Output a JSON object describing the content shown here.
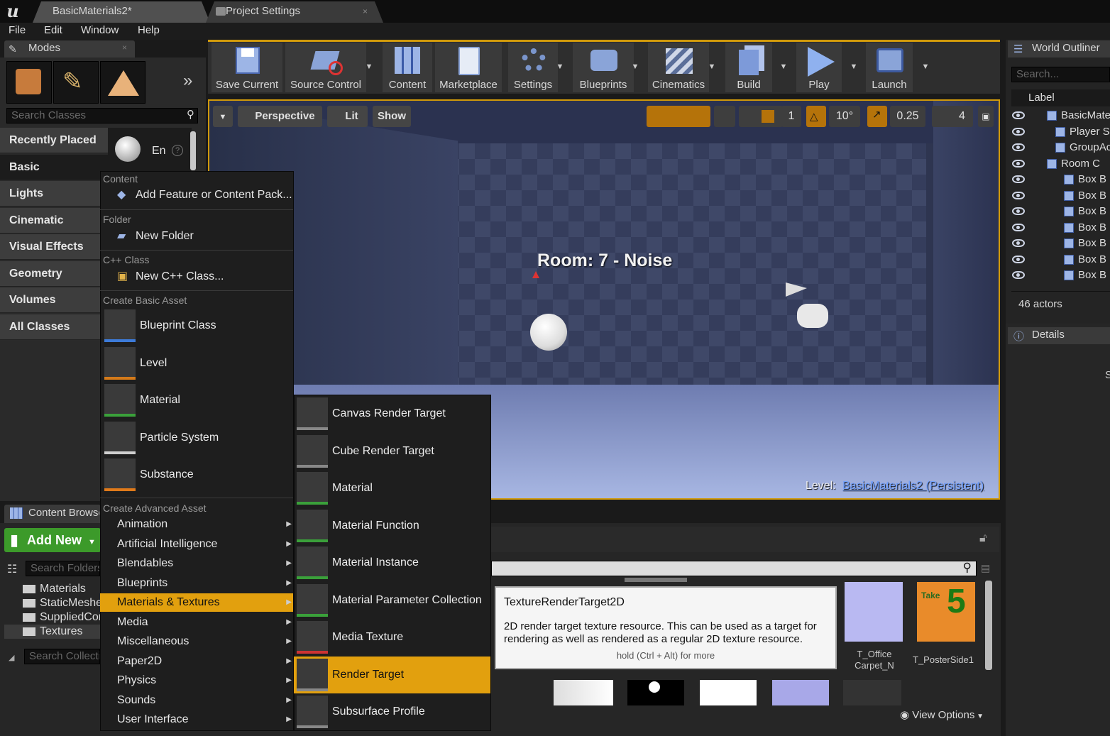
{
  "tabs": [
    {
      "label": "BasicMaterials2*"
    },
    {
      "label": "Project Settings"
    }
  ],
  "menubar": [
    "File",
    "Edit",
    "Window",
    "Help"
  ],
  "modes": {
    "title": "Modes",
    "search_placeholder": "Search Classes",
    "categories": [
      "Recently Placed",
      "Basic",
      "Lights",
      "Cinematic",
      "Visual Effects",
      "Geometry",
      "Volumes",
      "All Classes"
    ],
    "selected_category": "Basic",
    "placeable_label": "En"
  },
  "toolbar": {
    "buttons": [
      {
        "label": "Save Current",
        "icon": "save-icon"
      },
      {
        "label": "Source Control",
        "icon": "source-control-icon"
      },
      {
        "label": "Content",
        "icon": "content-icon"
      },
      {
        "label": "Marketplace",
        "icon": "marketplace-icon"
      },
      {
        "label": "Settings",
        "icon": "settings-icon"
      },
      {
        "label": "Blueprints",
        "icon": "blueprints-icon"
      },
      {
        "label": "Cinematics",
        "icon": "cinematics-icon"
      },
      {
        "label": "Build",
        "icon": "build-icon"
      },
      {
        "label": "Play",
        "icon": "play-icon"
      },
      {
        "label": "Launch",
        "icon": "launch-icon"
      }
    ]
  },
  "viewport": {
    "perspective": "Perspective",
    "lit": "Lit",
    "show": "Show",
    "grid_snap": "1",
    "rotation_snap": "10°",
    "scale_snap": "0.25",
    "camera_speed": "4",
    "room_text": "Room: 7 - Noise",
    "level_label": "Level:",
    "level_name": "BasicMaterials2 (Persistent)"
  },
  "world_outliner": {
    "title": "World Outliner",
    "search_placeholder": "Search...",
    "column": "Label",
    "rows": [
      "BasicMate",
      "Player S",
      "GroupAc",
      "Room C",
      "Box B",
      "Box B",
      "Box B",
      "Box B",
      "Box B",
      "Box B",
      "Box B",
      "Box B"
    ],
    "actor_count": "46 actors"
  },
  "details": {
    "title": "Details",
    "edge_text": "S"
  },
  "content_browser": {
    "title": "Content Browser",
    "add_new": "Add New",
    "search_folders": "Search Folders",
    "search_collections": "Search Collections",
    "folders": [
      "Materials",
      "StaticMeshes",
      "SuppliedContent",
      "Textures"
    ],
    "view_options": "View Options",
    "assets": [
      {
        "name": "T_Office Carpet_N"
      },
      {
        "name": "T_PosterSide1",
        "badge_word": "Take",
        "badge_number": "5"
      }
    ]
  },
  "context_menu": {
    "sections": {
      "content": "Content",
      "folder": "Folder",
      "cpp": "C++ Class",
      "basic": "Create Basic Asset",
      "advanced": "Create Advanced Asset"
    },
    "add_feature": "Add Feature or Content Pack...",
    "new_folder": "New Folder",
    "new_cpp": "New C++ Class...",
    "basic_assets": [
      "Blueprint Class",
      "Level",
      "Material",
      "Particle System",
      "Substance"
    ],
    "advanced_assets": [
      "Animation",
      "Artificial Intelligence",
      "Blendables",
      "Blueprints",
      "Materials & Textures",
      "Media",
      "Miscellaneous",
      "Paper2D",
      "Physics",
      "Sounds",
      "User Interface"
    ],
    "highlighted": "Materials & Textures"
  },
  "submenu": {
    "items": [
      "Canvas Render Target",
      "Cube Render Target",
      "Material",
      "Material Function",
      "Material Instance",
      "Material Parameter Collection",
      "Media Texture",
      "Render Target",
      "Subsurface Profile"
    ],
    "highlighted": "Render Target"
  },
  "tooltip": {
    "title": "TextureRenderTarget2D",
    "body": "2D render target texture resource. This can be used as a target for rendering as well as rendered as a regular 2D texture resource.",
    "hint": "hold (Ctrl + Alt) for more"
  },
  "colors": {
    "accent": "#e2a00e",
    "add_new": "#3c9a2a",
    "level_name": "#6f9fff"
  }
}
